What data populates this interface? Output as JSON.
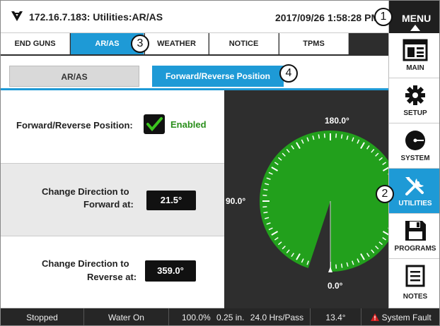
{
  "header": {
    "title": "172.16.7.183: Utilities:AR/AS",
    "datetime": "2017/09/26 1:58:28 PM"
  },
  "menu": {
    "label": "MENU",
    "items": [
      {
        "label": "MAIN",
        "icon": "main-icon"
      },
      {
        "label": "SETUP",
        "icon": "gear-icon"
      },
      {
        "label": "SYSTEM",
        "icon": "system-icon"
      },
      {
        "label": "UTILITIES",
        "icon": "tools-icon",
        "active": true
      },
      {
        "label": "PROGRAMS",
        "icon": "floppy-disk-icon"
      },
      {
        "label": "NOTES",
        "icon": "notes-icon"
      }
    ]
  },
  "tabs": [
    {
      "label": "END GUNS"
    },
    {
      "label": "AR/AS",
      "active": true
    },
    {
      "label": "WEATHER"
    },
    {
      "label": "NOTICE"
    },
    {
      "label": "TPMS"
    }
  ],
  "subtabs": [
    {
      "label": "AR/AS"
    },
    {
      "label": "Forward/Reverse Position",
      "active": true
    }
  ],
  "settings": {
    "fr_label": "Forward/Reverse Position:",
    "fr_status": "Enabled",
    "forward_label_1": "Change Direction to",
    "forward_label_2": "Forward at:",
    "forward_value": "21.5°",
    "reverse_label_1": "Change Direction to",
    "reverse_label_2": "Reverse at:",
    "reverse_value": "359.0°"
  },
  "dial": {
    "top_label": "180.0°",
    "left_label": "90.0°",
    "bottom_label": "0.0°"
  },
  "status_bar": {
    "state": "Stopped",
    "water": "Water On",
    "speed": "100.0%",
    "depth": "0.25 in.",
    "pass": "24.0 Hrs/Pass",
    "angle": "13.4°",
    "fault": "System Fault"
  },
  "callouts": [
    "1",
    "2",
    "3",
    "4"
  ],
  "colors": {
    "accent": "#1e9ad6",
    "dial_green": "#22a01c",
    "enabled_green": "#2a8f1b",
    "fault_red": "#d42020"
  }
}
